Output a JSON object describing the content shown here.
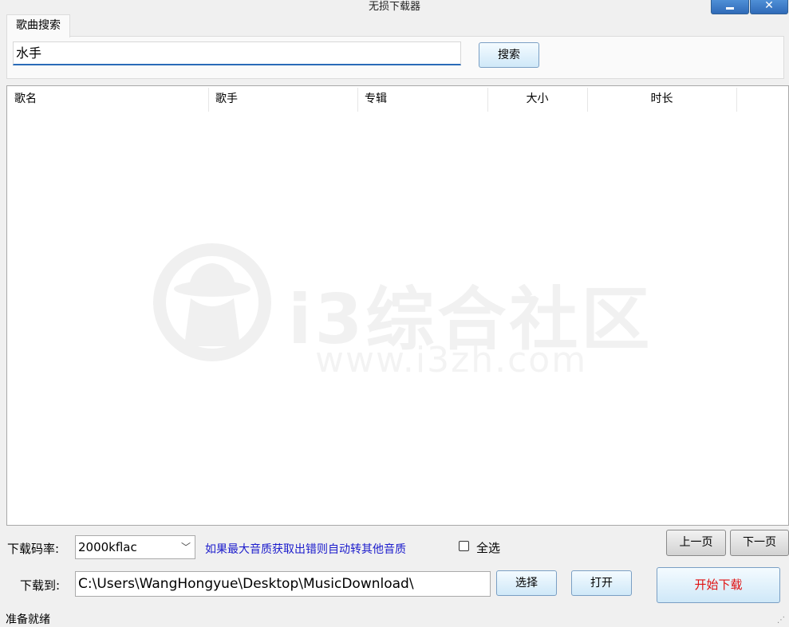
{
  "window": {
    "title": "无损下载器",
    "minimize_icon": "minimize-icon",
    "close_icon": "close-icon",
    "close_glyph": "✕"
  },
  "tab": {
    "label": "歌曲搜索"
  },
  "search": {
    "value": "水手",
    "button_label": "搜索"
  },
  "list": {
    "columns": [
      "歌名",
      "歌手",
      "专辑",
      "大小",
      "时长"
    ],
    "rows": []
  },
  "watermark": {
    "text": "i3综合社区",
    "url": "www.i3zh.com",
    "icon": "detective-logo-icon"
  },
  "bitrate": {
    "label": "下载码率:",
    "selected": "2000kflac",
    "arrow_icon": "chevron-down-icon",
    "arrow_glyph": "﹀",
    "hint": "如果最大音质获取出错则自动转其他音质"
  },
  "select_all": {
    "label": "全选",
    "checked": false
  },
  "paging": {
    "prev_label": "上一页",
    "next_label": "下一页"
  },
  "destination": {
    "label": "下载到:",
    "path": "C:\\Users\\WangHongyue\\Desktop\\MusicDownload\\",
    "choose_label": "选择",
    "open_label": "打开"
  },
  "start_download": {
    "label": "开始下载",
    "color": "#e01010"
  },
  "status": {
    "text": "准备就绪",
    "grip_glyph": "⋰"
  }
}
